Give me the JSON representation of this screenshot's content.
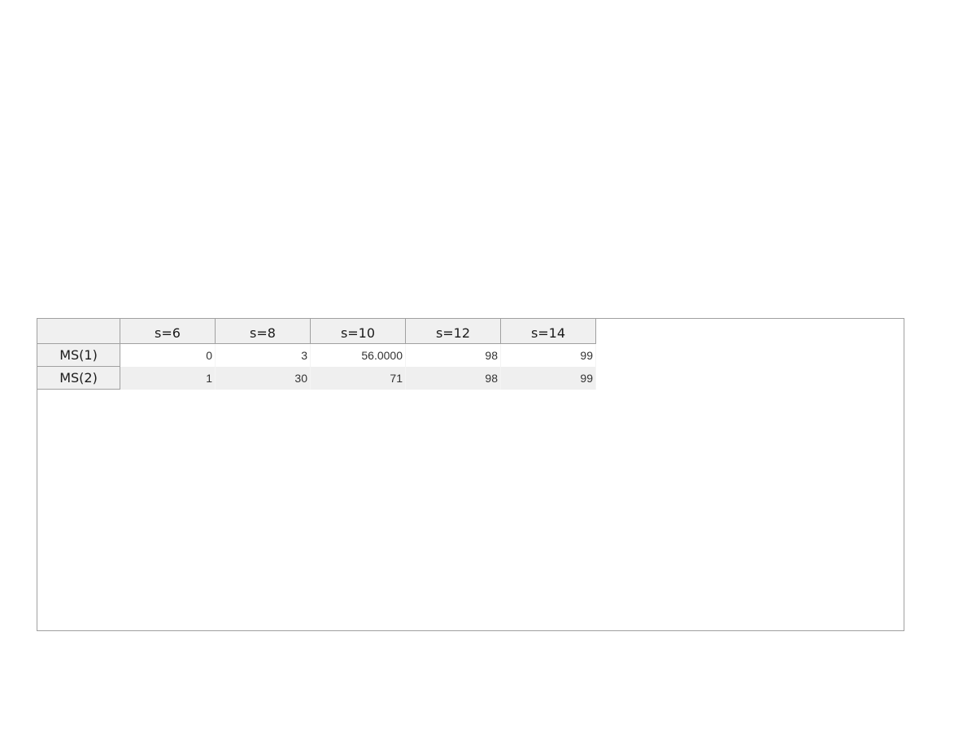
{
  "table": {
    "columns": [
      "s=6",
      "s=8",
      "s=10",
      "s=12",
      "s=14"
    ],
    "rows": [
      {
        "label": "MS(1)",
        "values": [
          "0",
          "3",
          "56.0000",
          "98",
          "99"
        ]
      },
      {
        "label": "MS(2)",
        "values": [
          "1",
          "30",
          "71",
          "98",
          "99"
        ]
      }
    ]
  },
  "colors": {
    "header_bg": "#f0f0f0",
    "border": "#a0a0a0",
    "stripe_bg": "#efefef"
  }
}
